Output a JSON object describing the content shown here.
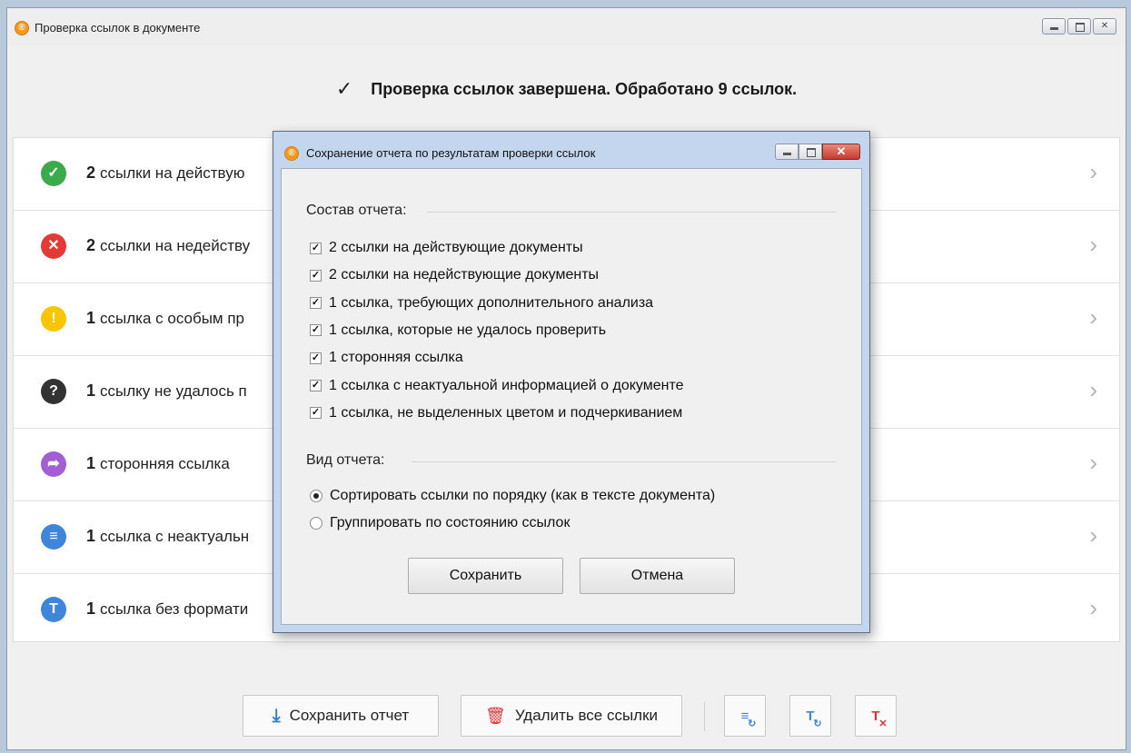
{
  "main_window": {
    "title": "Проверка ссылок в документе",
    "completion_text": "Проверка ссылок завершена. Обработано 9 ссылок.",
    "rows": [
      {
        "count": "2",
        "text": "ссылки на действую",
        "icon": "✓",
        "color": "#3aaa4a",
        "icon_name": "check-circle-icon"
      },
      {
        "count": "2",
        "text": "ссылки на недейству",
        "icon": "✕",
        "color": "#e53935",
        "icon_name": "error-circle-icon"
      },
      {
        "count": "1",
        "text": "ссылка с особым пр",
        "icon": "!",
        "color": "#f7c600",
        "icon_name": "warning-circle-icon"
      },
      {
        "count": "1",
        "text": "ссылку не удалось п",
        "icon": "?",
        "color": "#333333",
        "icon_name": "question-circle-icon"
      },
      {
        "count": "1",
        "text": "сторонняя ссылка",
        "icon": "➦",
        "color": "#a35ed6",
        "icon_name": "external-link-circle-icon"
      },
      {
        "count": "1",
        "text": "ссылка с неактуальн",
        "icon": "≡",
        "color": "#3f86d9",
        "icon_name": "info-list-circle-icon"
      },
      {
        "count": "1",
        "text": "ссылка без формати",
        "icon": "T",
        "color": "#3f86d9",
        "icon_name": "format-circle-icon"
      }
    ],
    "toolbar": {
      "save_report": "Сохранить отчет",
      "delete_all": "Удалить все ссылки"
    }
  },
  "dialog": {
    "title": "Сохранение отчета по результатам проверки ссылок",
    "composition_label": "Состав отчета:",
    "checkboxes": [
      {
        "label": "2 ссылки на действующие документы",
        "checked": true
      },
      {
        "label": "2 ссылки на недействующие документы",
        "checked": true
      },
      {
        "label": "1 ссылка, требующих дополнительного анализа",
        "checked": true
      },
      {
        "label": "1 ссылка, которые не удалось проверить",
        "checked": true
      },
      {
        "label": "1 сторонняя ссылка",
        "checked": true
      },
      {
        "label": "1 ссылка с неактуальной информацией о документе",
        "checked": true
      },
      {
        "label": "1 ссылка, не выделенных цветом и подчеркиванием",
        "checked": true
      }
    ],
    "view_label": "Вид отчета:",
    "radios": [
      {
        "label": "Сортировать ссылки по порядку (как в тексте документа)",
        "selected": true
      },
      {
        "label": "Группировать по состоянию ссылок",
        "selected": false
      }
    ],
    "save_button": "Сохранить",
    "cancel_button": "Отмена"
  }
}
